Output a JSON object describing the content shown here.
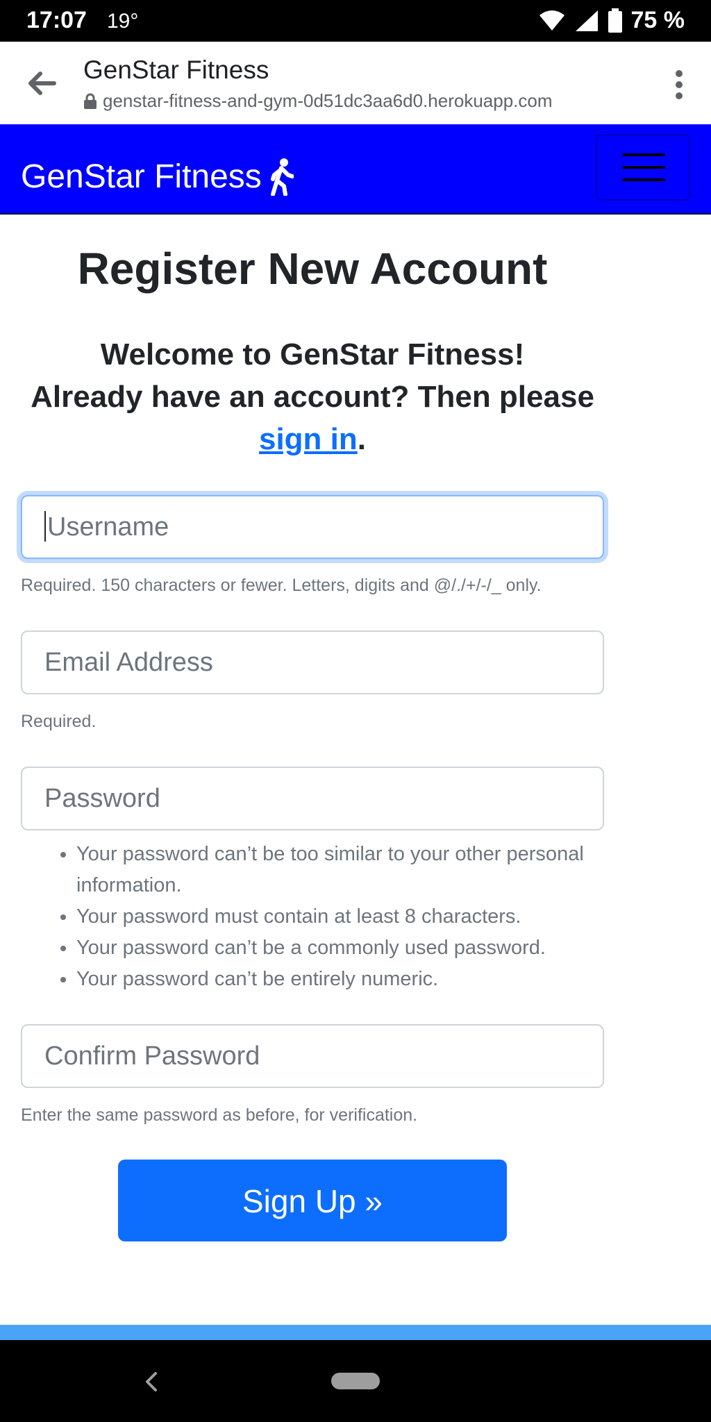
{
  "status_bar": {
    "time": "17:07",
    "temperature": "19°",
    "battery": "75 %"
  },
  "browser": {
    "title": "GenStar Fitness",
    "url": "genstar-fitness-and-gym-0d51dc3aa6d0.herokuapp.com",
    "icons": [
      "back-arrow-icon",
      "lock-icon",
      "more-vert-icon"
    ]
  },
  "navbar": {
    "brand": "GenStar Fitness",
    "brand_icon": "walking-person-icon",
    "background_color": "#0000ff"
  },
  "page": {
    "title": "Register New Account",
    "welcome_line1": "Welcome to GenStar Fitness!",
    "welcome_line2": "Already have an account? Then please",
    "sign_in_link": "sign in",
    "welcome_end": "."
  },
  "form": {
    "username": {
      "placeholder": "Username",
      "help": "Required. 150 characters or fewer. Letters, digits and @/./+/-/_ only."
    },
    "email": {
      "placeholder": "Email Address",
      "help": "Required."
    },
    "password": {
      "placeholder": "Password",
      "rules": [
        "Your password can’t be too similar to your other personal information.",
        "Your password must contain at least 8 characters.",
        "Your password can’t be a commonly used password.",
        "Your password can’t be entirely numeric."
      ]
    },
    "confirm_password": {
      "placeholder": "Confirm Password",
      "help": "Enter the same password as before, for verification."
    },
    "submit_label": "Sign Up »",
    "accent_color": "#0d6efd"
  }
}
